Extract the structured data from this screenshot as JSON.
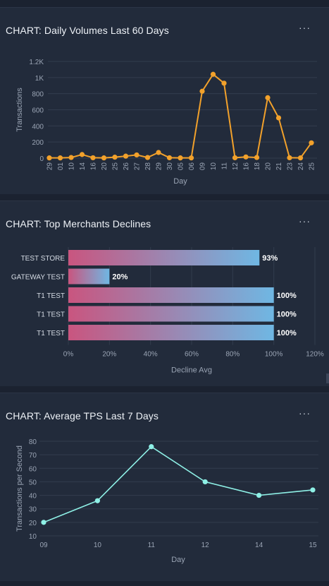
{
  "colors": {
    "background": "#1b2230",
    "panel": "#222b3b",
    "grid": "#323c4e",
    "axis_text": "#9aa4b4",
    "line_orange": "#f2a12b",
    "line_cyan": "#8ef0e6",
    "bar_start": "#c9557f",
    "bar_end": "#6fb7e3"
  },
  "panels": [
    {
      "title": "CHART: Daily Volumes Last 60 Days",
      "menu_icon": "more-horizontal-icon",
      "menu_label": "···"
    },
    {
      "title": "CHART: Top Merchants Declines",
      "menu_icon": "more-horizontal-icon",
      "menu_label": "···"
    },
    {
      "title": "CHART: Average TPS Last 7 Days",
      "menu_icon": "more-horizontal-icon",
      "menu_label": "···"
    }
  ],
  "chart_data": [
    {
      "type": "line",
      "title": "CHART: Daily Volumes Last 60 Days",
      "xlabel": "Day",
      "ylabel": "Transactions",
      "ylim": [
        0,
        1200
      ],
      "yticks": [
        0,
        200,
        400,
        600,
        800,
        1000,
        1200
      ],
      "ytick_labels": [
        "0",
        "200",
        "400",
        "600",
        "800",
        "1K",
        "1.2K"
      ],
      "grid": true,
      "categories": [
        "29",
        "01",
        "10",
        "14",
        "16",
        "20",
        "25",
        "26",
        "27",
        "28",
        "29",
        "30",
        "05",
        "06",
        "09",
        "10",
        "11",
        "12",
        "16",
        "18",
        "20",
        "21",
        "23",
        "24",
        "25"
      ],
      "series": [
        {
          "values": [
            3,
            3,
            8,
            45,
            5,
            3,
            12,
            25,
            40,
            8,
            70,
            5,
            3,
            3,
            830,
            1040,
            930,
            5,
            15,
            8,
            750,
            500,
            5,
            3,
            190
          ]
        }
      ]
    },
    {
      "type": "bar",
      "orientation": "horizontal",
      "title": "CHART: Top Merchants Declines",
      "xlabel": "Decline Avg",
      "xlim": [
        0,
        120
      ],
      "xticks": [
        0,
        20,
        40,
        60,
        80,
        100,
        120
      ],
      "xtick_labels": [
        "0%",
        "20%",
        "40%",
        "60%",
        "80%",
        "100%",
        "120%"
      ],
      "grid": true,
      "categories": [
        "TEST STORE",
        "GATEWAY TEST",
        "T1 TEST",
        "T1 TEST",
        "T1 TEST"
      ],
      "values": [
        93,
        20,
        100,
        100,
        100
      ],
      "value_labels": [
        "93%",
        "20%",
        "100%",
        "100%",
        "100%"
      ]
    },
    {
      "type": "line",
      "title": "CHART: Average TPS Last 7 Days",
      "xlabel": "Day",
      "ylabel": "Transactions per Second",
      "ylim": [
        10,
        80
      ],
      "yticks": [
        10,
        20,
        30,
        40,
        50,
        60,
        70,
        80
      ],
      "ytick_labels": [
        "10",
        "20",
        "30",
        "40",
        "50",
        "60",
        "70",
        "80"
      ],
      "grid": true,
      "categories": [
        "09",
        "10",
        "11",
        "12",
        "14",
        "15"
      ],
      "series": [
        {
          "values": [
            20,
            36,
            76,
            50,
            40,
            44
          ]
        }
      ]
    }
  ]
}
